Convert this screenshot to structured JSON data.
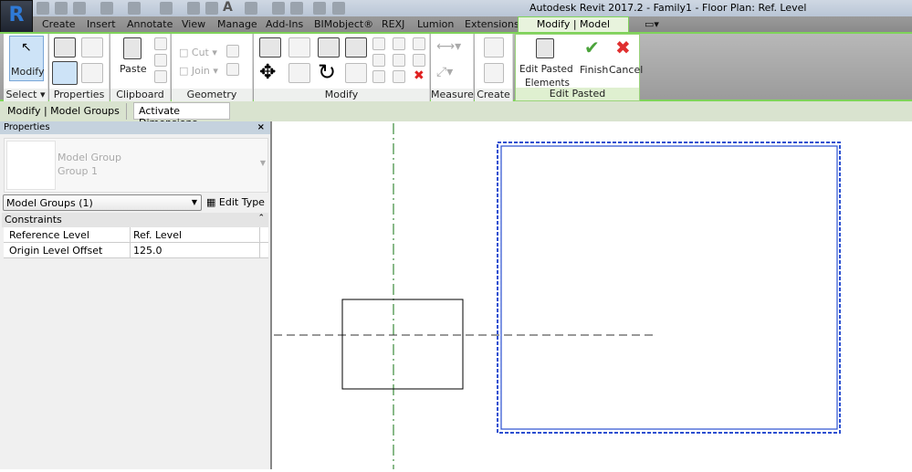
{
  "title": "Autodesk Revit 2017.2 -     Family1 - Floor Plan: Ref. Level",
  "app_button": "R",
  "tabs": [
    "Create",
    "Insert",
    "Annotate",
    "View",
    "Manage",
    "Add-Ins",
    "BIMobject®",
    "REXJ",
    "Lumion",
    "Extensions"
  ],
  "active_tab": "Modify | Model Groups",
  "ribbon": {
    "modify": "Modify",
    "select": "Select ▾",
    "properties": "Properties",
    "paste": "Paste",
    "clipboard": "Clipboard",
    "cut": "Cut",
    "join": "Join",
    "geometry": "Geometry",
    "modify_panel": "Modify",
    "measure": "Measure",
    "create": "Create",
    "edit_pasted_1": "Edit Pasted",
    "edit_pasted_2": "Elements",
    "finish": "Finish",
    "cancel": "Cancel",
    "edit_pasted_panel": "Edit Pasted"
  },
  "options_bar": {
    "context": "Modify | Model Groups",
    "activate_dimensions": "Activate Dimensions"
  },
  "properties": {
    "header": "Properties",
    "close": "×",
    "type_line1": "Model Group",
    "type_line2": "Group 1",
    "selector": "Model Groups (1)",
    "edit_type": "Edit Type",
    "section": "Constraints",
    "rows": [
      {
        "name": "Reference Level",
        "value": "Ref. Level"
      },
      {
        "name": "Origin Level Offset",
        "value": "125.0"
      }
    ]
  },
  "colors": {
    "accent": "#7fd35a",
    "selection": "#2a4fd0",
    "ref_plane": "#3a8a3a"
  }
}
